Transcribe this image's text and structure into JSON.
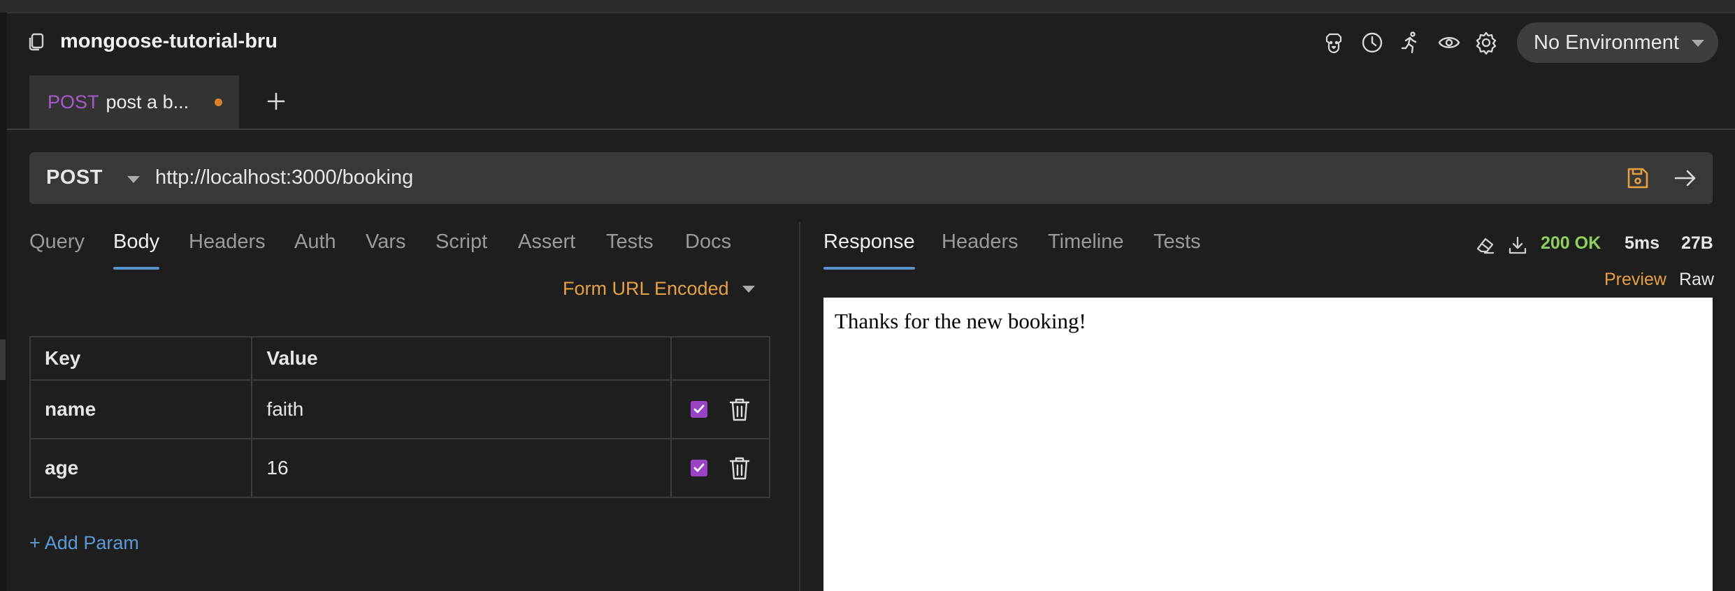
{
  "collection": {
    "title": "mongoose-tutorial-bru",
    "icon": "collection-copy-icon"
  },
  "header_icons": [
    "dog-icon",
    "history-clock-icon",
    "runner-icon",
    "eye-icon",
    "settings-gear-icon"
  ],
  "environment": {
    "label": "No Environment"
  },
  "request_tab": {
    "method": "POST",
    "name": "post a b...",
    "unsaved_dot_color": "#d9822b"
  },
  "url_bar": {
    "method": "POST",
    "url": "http://localhost:3000/booking"
  },
  "request_tabs": [
    "Query",
    "Body",
    "Headers",
    "Auth",
    "Vars",
    "Script",
    "Assert",
    "Tests",
    "Docs"
  ],
  "active_request_tab": "Body",
  "body_mode": "Form URL Encoded",
  "params_table": {
    "headers": [
      "Key",
      "Value",
      ""
    ],
    "rows": [
      {
        "key": "name",
        "value": "faith",
        "enabled": true
      },
      {
        "key": "age",
        "value": "16",
        "enabled": true
      }
    ]
  },
  "add_param_label": "+ Add Param",
  "response_tabs": [
    "Response",
    "Headers",
    "Timeline",
    "Tests"
  ],
  "active_response_tab": "Response",
  "response_status": {
    "code_text": "200 OK",
    "time": "5ms",
    "size": "27B"
  },
  "response_view": {
    "preview": "Preview",
    "raw": "Raw"
  },
  "response_body": "Thanks for the new booking!",
  "colors": {
    "background": "#1e1e1e",
    "method_post": "#a45ac8",
    "accent_orange": "#e6a042",
    "status_ok": "#8fcf5c",
    "link_blue": "#5b9ad6",
    "active_tab_underline": "#5b8fc9",
    "checkbox": "#9a43c4"
  }
}
